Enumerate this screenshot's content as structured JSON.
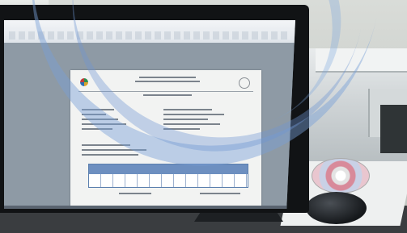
{
  "photo": {
    "subject": "office-monitor-with-document",
    "colors": {
      "monitor_bezel": "#111315",
      "document_table_header": "#6d8fc0",
      "watermark": "#78a0d7"
    },
    "icons": [
      "monitor-icon",
      "printer-icon",
      "cd-icon",
      "mouse-icon",
      "logo-icon"
    ]
  }
}
